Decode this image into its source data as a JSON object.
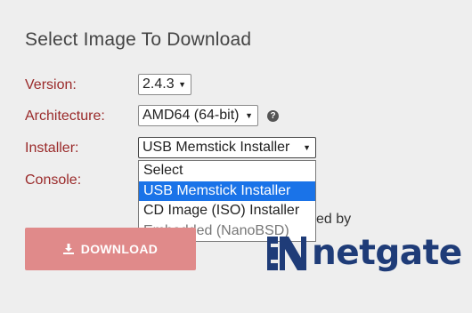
{
  "page_title": "Select Image To Download",
  "fields": {
    "version": {
      "label": "Version:",
      "value": "2.4.3"
    },
    "architecture": {
      "label": "Architecture:",
      "value": "AMD64 (64-bit)"
    },
    "installer": {
      "label": "Installer:",
      "value": "USB Memstick Installer",
      "options": [
        "Select",
        "USB Memstick Installer",
        "CD Image (ISO) Installer",
        "Embedded (NanoBSD)"
      ]
    },
    "console": {
      "label": "Console:"
    }
  },
  "download_label": "DOWNLOAD",
  "powered_by_visible": "ed by",
  "brand": "netgate",
  "colors": {
    "label_red": "#9a2a2a",
    "download_bg": "#e08a8a",
    "selected_option": "#1a73e8",
    "brand_blue": "#1f3c78"
  }
}
